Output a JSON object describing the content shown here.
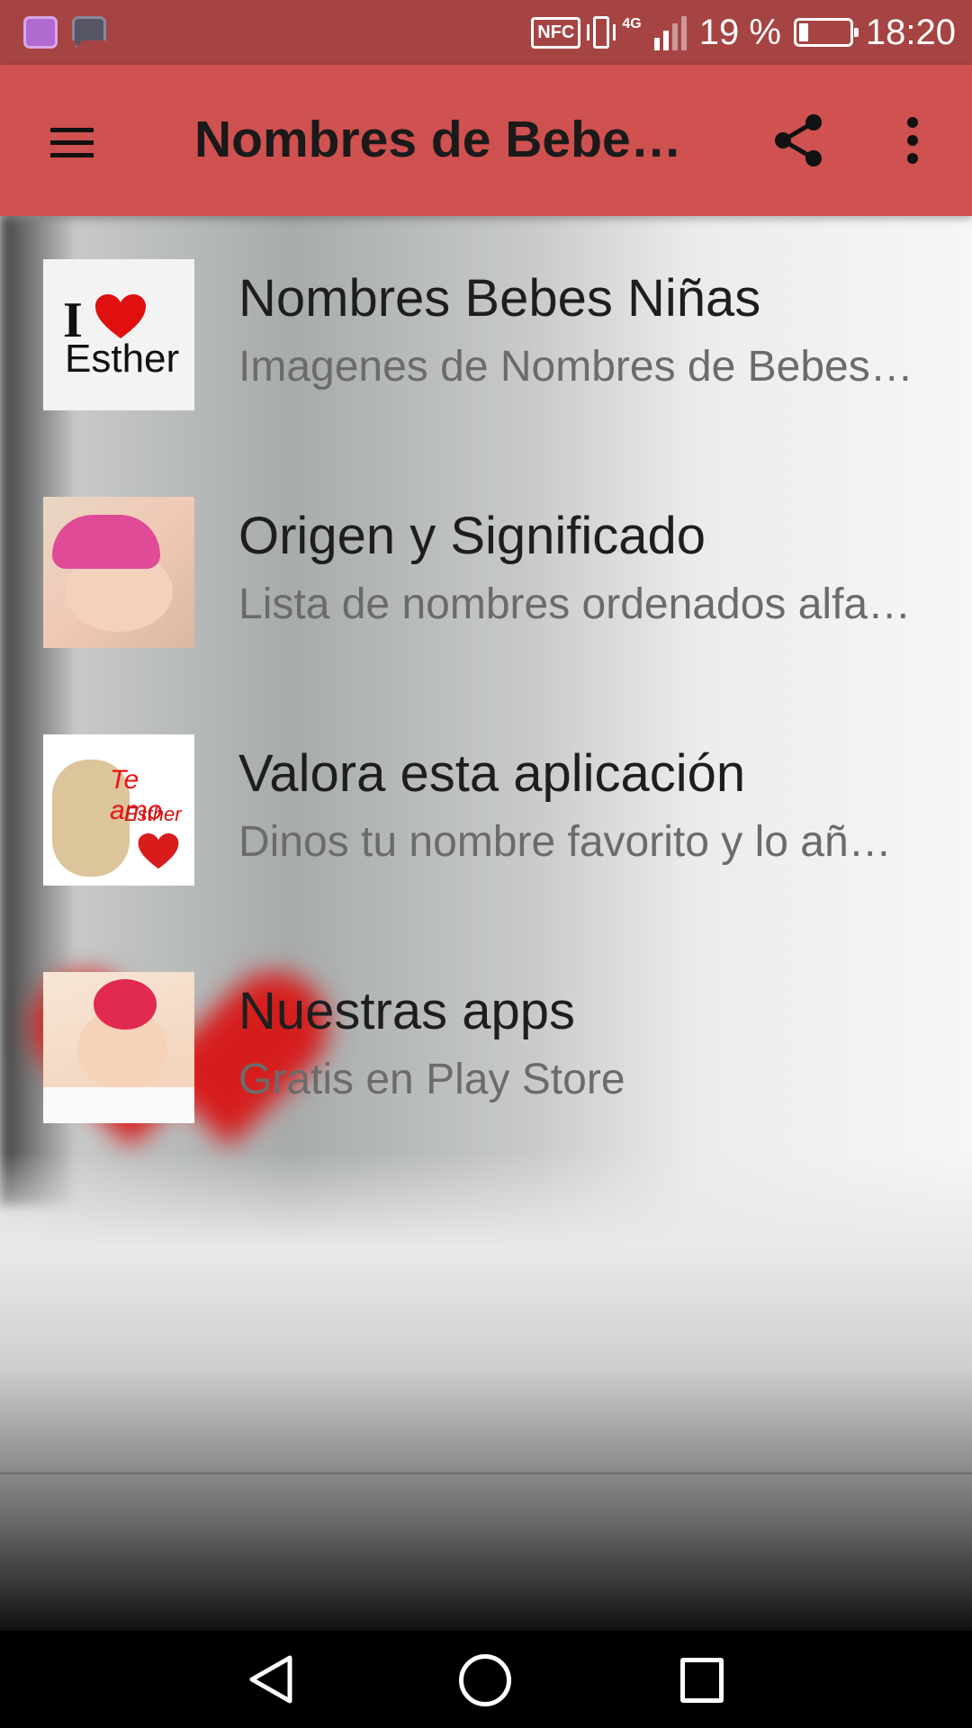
{
  "status_bar": {
    "battery_percent_text": "19 %",
    "battery_level": 0.19,
    "network_type": "4G",
    "nfc_label": "NFC",
    "time": "18:20",
    "notification_icons": [
      "gallery-notification-icon",
      "chart-notification-icon"
    ]
  },
  "app_bar": {
    "title": "Nombres de Bebes de Nombre de Niña",
    "menu_icon": "hamburger-menu-icon",
    "share_icon": "share-icon",
    "more_icon": "more-vert-icon"
  },
  "thumbnails": {
    "item1": {
      "heart_word": "I",
      "name": "Esther"
    },
    "item3": {
      "line1": "Te amo",
      "line2": "Esther"
    }
  },
  "items": [
    {
      "title": "Nombres Bebes Niñas",
      "subtitle": "Imagenes de Nombres de Bebes de Niña"
    },
    {
      "title": "Origen y Significado",
      "subtitle": "Lista de nombres ordenados alfabeticamente"
    },
    {
      "title": "Valora esta aplicación",
      "subtitle": "Dinos tu nombre favorito y lo añadiremos"
    },
    {
      "title": "Nuestras apps",
      "subtitle": "Gratis en Play Store"
    }
  ],
  "nav_bar": {
    "back_icon": "back-triangle-icon",
    "home_icon": "home-circle-icon",
    "recents_icon": "recents-square-icon"
  },
  "colors": {
    "status_bar": "#a64444",
    "app_bar": "#cf5150",
    "title_text": "#1e1e1e",
    "subtitle_text": "#6b6b6b",
    "nav_bar": "#000000"
  }
}
